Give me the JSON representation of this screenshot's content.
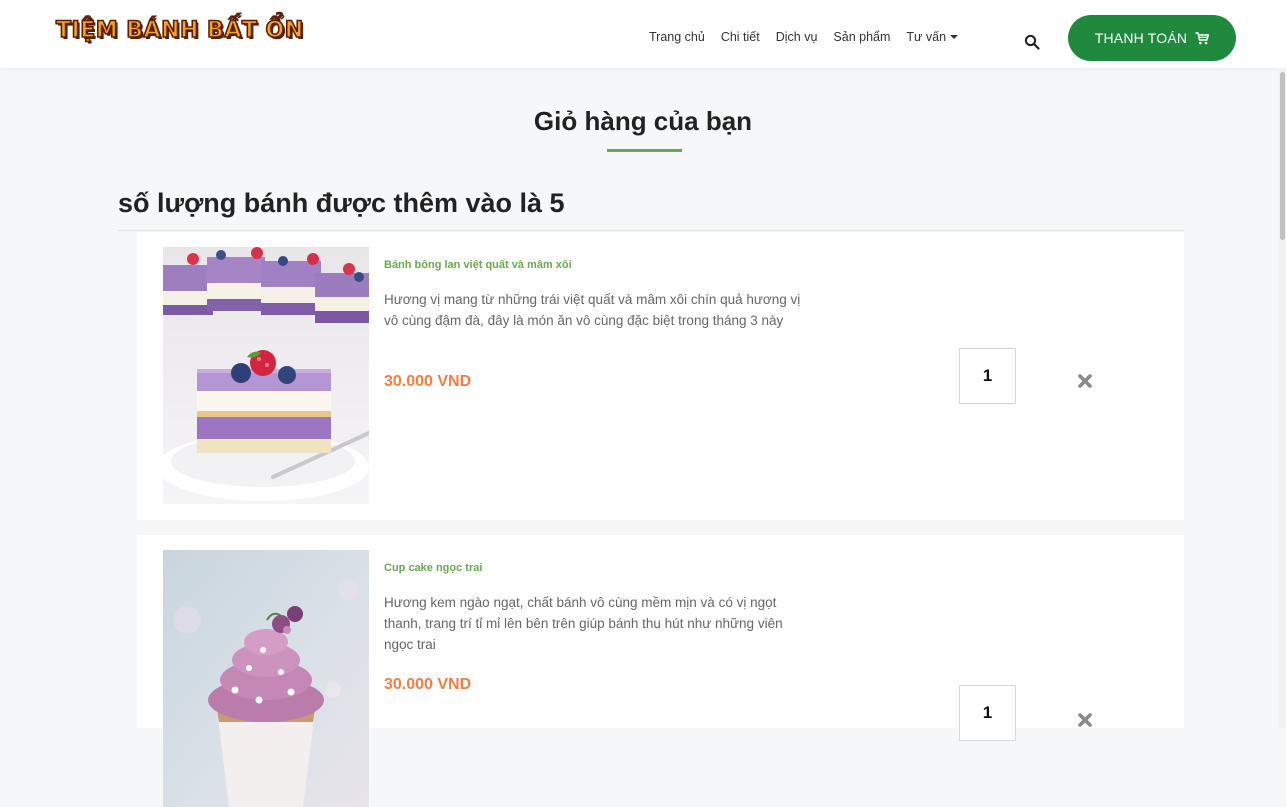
{
  "brand": {
    "logo_text": "TIỆM BÁNH BẤT ỔN"
  },
  "nav": {
    "items": [
      {
        "label": "Trang chủ"
      },
      {
        "label": "Chi tiết"
      },
      {
        "label": "Dịch vụ"
      },
      {
        "label": "Sản phẩm"
      },
      {
        "label": "Tư vấn"
      }
    ],
    "search_icon": "search-icon",
    "checkout_label": "THANH TOÁN",
    "checkout_icon": "cart-icon"
  },
  "page": {
    "title": "Giỏ hàng của bạn",
    "count_heading": "số lượng bánh được thêm vào là 5"
  },
  "cart": {
    "items": [
      {
        "name": "Bánh bông lan việt quất và mâm xôi",
        "description": "Hương vị mang từ những trái việt quất và mâm xôi chín quả hương vị vô cùng đậm đà, đây là món ăn vô cùng đặc biệt trong tháng 3 này",
        "price": "30.000 VND",
        "quantity": "1",
        "remove_icon": "close-icon"
      },
      {
        "name": "Cup cake ngọc trai",
        "description": "Hương kem ngào ngạt, chất bánh vô cùng mềm mịn và có vị ngọt thanh, trang trí tỉ mỉ lên bên trên giúp bánh thu hút như những viên ngọc trai",
        "price": "30.000 VND",
        "quantity": "1",
        "remove_icon": "close-icon"
      }
    ]
  },
  "colors": {
    "brand_green": "#1f8a3d",
    "accent_green": "#6aa84f",
    "price_orange": "#f07f43",
    "logo_orange": "#f7a51c",
    "logo_outline": "#5a1e0a"
  }
}
